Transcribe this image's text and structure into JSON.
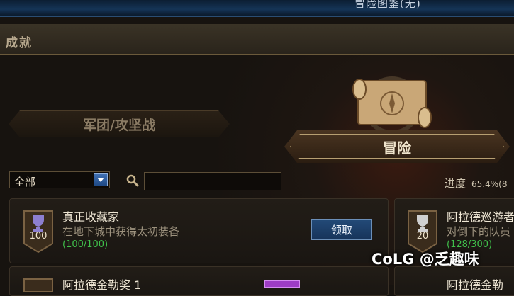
{
  "window": {
    "title": "冒险图鉴(无)"
  },
  "header": {
    "title": "成就"
  },
  "tabs": {
    "legion": "军团/攻坚战",
    "adventure": "冒险"
  },
  "filter": {
    "selected": "全部",
    "search_placeholder": ""
  },
  "progress": {
    "label": "进度",
    "value": "65.4%(8"
  },
  "achievements": [
    {
      "points": "100",
      "title": "真正收藏家",
      "desc": "在地下城中获得太初装备",
      "progress": "(100/100)",
      "button": "领取"
    },
    {
      "points": "20",
      "title": "阿拉德巡游者",
      "desc": "对倒下的队员",
      "progress": "(128/300)"
    },
    {
      "title": "阿拉德金勒奖 1"
    },
    {
      "title": "阿拉德金勒"
    }
  ],
  "watermark": "CoLG @乏趣味"
}
